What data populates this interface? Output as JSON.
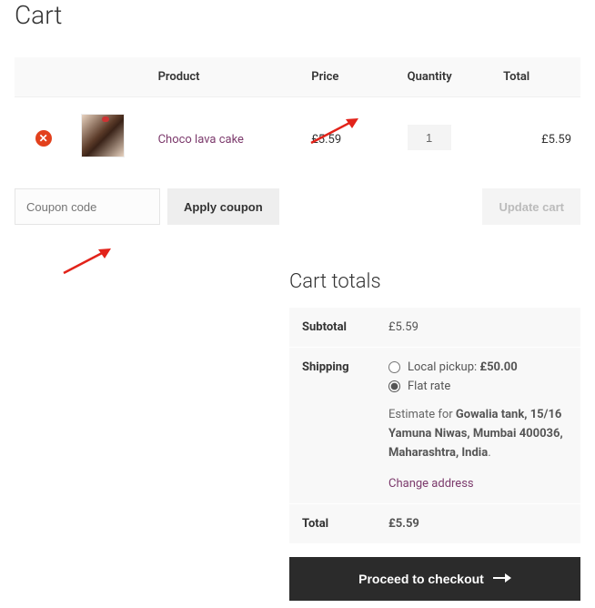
{
  "page_title": "Cart",
  "table": {
    "headers": {
      "product": "Product",
      "price": "Price",
      "quantity": "Quantity",
      "total": "Total"
    },
    "items": [
      {
        "name": "Choco lava cake",
        "price": "£5.59",
        "qty": "1",
        "total": "£5.59"
      }
    ]
  },
  "coupon": {
    "placeholder": "Coupon code",
    "apply_label": "Apply coupon",
    "update_label": "Update cart"
  },
  "totals": {
    "heading": "Cart totals",
    "subtotal_label": "Subtotal",
    "subtotal": "£5.59",
    "shipping_label": "Shipping",
    "shipping_options": [
      {
        "label": "Local pickup: ",
        "amount": "£50.00",
        "selected": false
      },
      {
        "label": "Flat rate",
        "amount": "",
        "selected": true
      }
    ],
    "estimate_prefix": "Estimate for ",
    "estimate_address": "Gowalia tank, 15/16 Yamuna Niwas, Mumbai 400036, Maharashtra, India",
    "change_address": "Change address",
    "total_label": "Total",
    "total": "£5.59"
  },
  "checkout_label": "Proceed to checkout"
}
